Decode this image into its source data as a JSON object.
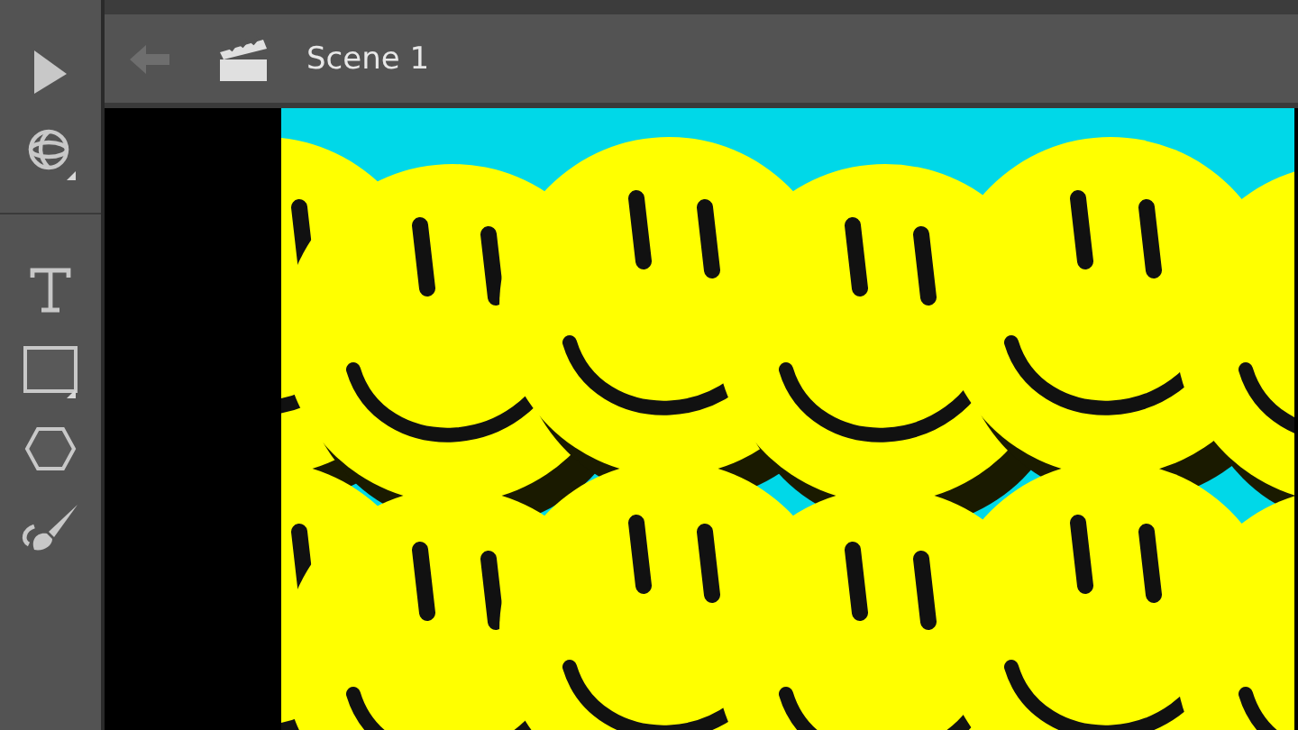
{
  "tools": [
    {
      "kind": "selection",
      "has_menu": false
    },
    {
      "kind": "orbit",
      "has_menu": true
    },
    {
      "kind": "text",
      "has_menu": false
    },
    {
      "kind": "rectangle",
      "has_menu": true
    },
    {
      "kind": "polygon",
      "has_menu": false
    },
    {
      "kind": "brush",
      "has_menu": false
    }
  ],
  "breadcrumb": {
    "back_disabled": true,
    "scene": "Scene 1"
  }
}
